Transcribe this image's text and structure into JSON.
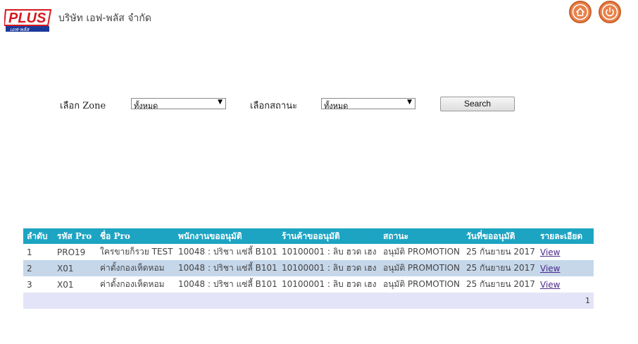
{
  "header": {
    "logo_text": "PLUS",
    "logo_subtext": "เอฟ-พลัส",
    "company_name": "บริษัท เอฟ-พลัส จำกัด",
    "home_icon": "home-icon",
    "power_icon": "power-icon"
  },
  "filters": {
    "zone_label": "เลือก Zone",
    "zone_value": "ทั้งหมด",
    "status_label": "เลือกสถานะ",
    "status_value": "ทั้งหมด",
    "search_label": "Search"
  },
  "table": {
    "columns": [
      "ลำดับ",
      "รหัส Pro",
      "ชื่อ Pro",
      "พนักงานขออนุมัติ",
      "ร้านค้าขออนุมัติ",
      "สถานะ",
      "วันที่ขออนุมัติ",
      "รายละเอียด"
    ],
    "rows": [
      {
        "no": "1",
        "code": "PRO19",
        "name": "ใครขายก็รวย TEST",
        "employee": "10048 : ปริชา แซ่ลี้ B101",
        "shop": "10100001 : ลิบ ฮวด เฮง",
        "status": "อนุมัติ PROMOTION",
        "date": "25 กันยายน 2017",
        "detail": "View"
      },
      {
        "no": "2",
        "code": "X01",
        "name": "ค่าตั้งกองเห็ดหอม",
        "employee": "10048 : ปริชา แซ่ลี้ B101",
        "shop": "10100001 : ลิบ ฮวด เฮง",
        "status": "อนุมัติ PROMOTION",
        "date": "25 กันยายน 2017",
        "detail": "View"
      },
      {
        "no": "3",
        "code": "X01",
        "name": "ค่าตั้งกองเห็ดหอม",
        "employee": "10048 : ปริชา แซ่ลี้ B101",
        "shop": "10100001 : ลิบ ฮวด เฮง",
        "status": "อนุมัติ PROMOTION",
        "date": "25 กันยายน 2017",
        "detail": "View"
      }
    ],
    "pager": "1"
  },
  "colors": {
    "header_bg": "#1da4c3",
    "alt_row": "#c6d7ea",
    "pager_bg": "#e4e4f8",
    "accent_orange": "#e8824a",
    "logo_red": "#d7191f"
  }
}
